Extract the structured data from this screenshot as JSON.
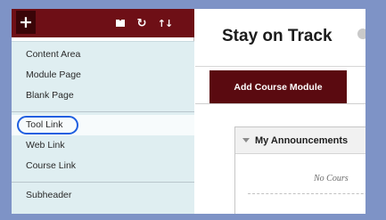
{
  "toolbar": {
    "add_icon": "plus-icon",
    "book_icon": "book-icon",
    "refresh_icon": "refresh-icon",
    "sort_icon": "sort-icon",
    "colors": {
      "toolbar_bg": "#6e0f16",
      "add_bg": "#3a0508"
    }
  },
  "menu": {
    "groups": [
      {
        "items": [
          "Content Area",
          "Module Page",
          "Blank Page"
        ]
      },
      {
        "items": [
          "Tool Link",
          "Web Link",
          "Course Link"
        ]
      },
      {
        "items": [
          "Subheader"
        ]
      }
    ],
    "highlighted": "Tool Link",
    "highlight_color": "#1f5fe0"
  },
  "content": {
    "title": "Stay on Track",
    "module_button": "Add Course Module",
    "announcements": {
      "title": "My Announcements",
      "empty_text": "No Cours"
    }
  }
}
